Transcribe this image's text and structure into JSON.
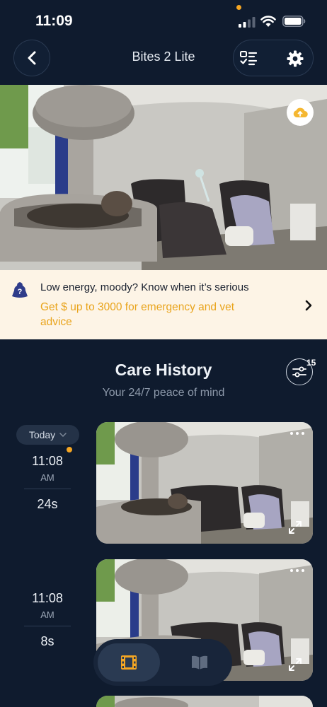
{
  "status_bar": {
    "time": "11:09"
  },
  "header": {
    "title": "Bites 2 Lite"
  },
  "banner": {
    "line1": "Low energy, moody? Know when it’s serious",
    "line2": "Get $ up to 3000 for emergency and vet advice"
  },
  "care_history": {
    "title": "Care History",
    "subtitle": "Your 24/7 peace of mind",
    "filter_count": "15",
    "day_filter": "Today",
    "entries": [
      {
        "time": "11:08",
        "ampm": "AM",
        "duration": "24s"
      },
      {
        "time": "11:08",
        "ampm": "AM",
        "duration": "8s"
      }
    ]
  },
  "colors": {
    "background": "#0f1b2e",
    "accent": "#f5a623",
    "banner_bg": "#fdf4e6"
  }
}
